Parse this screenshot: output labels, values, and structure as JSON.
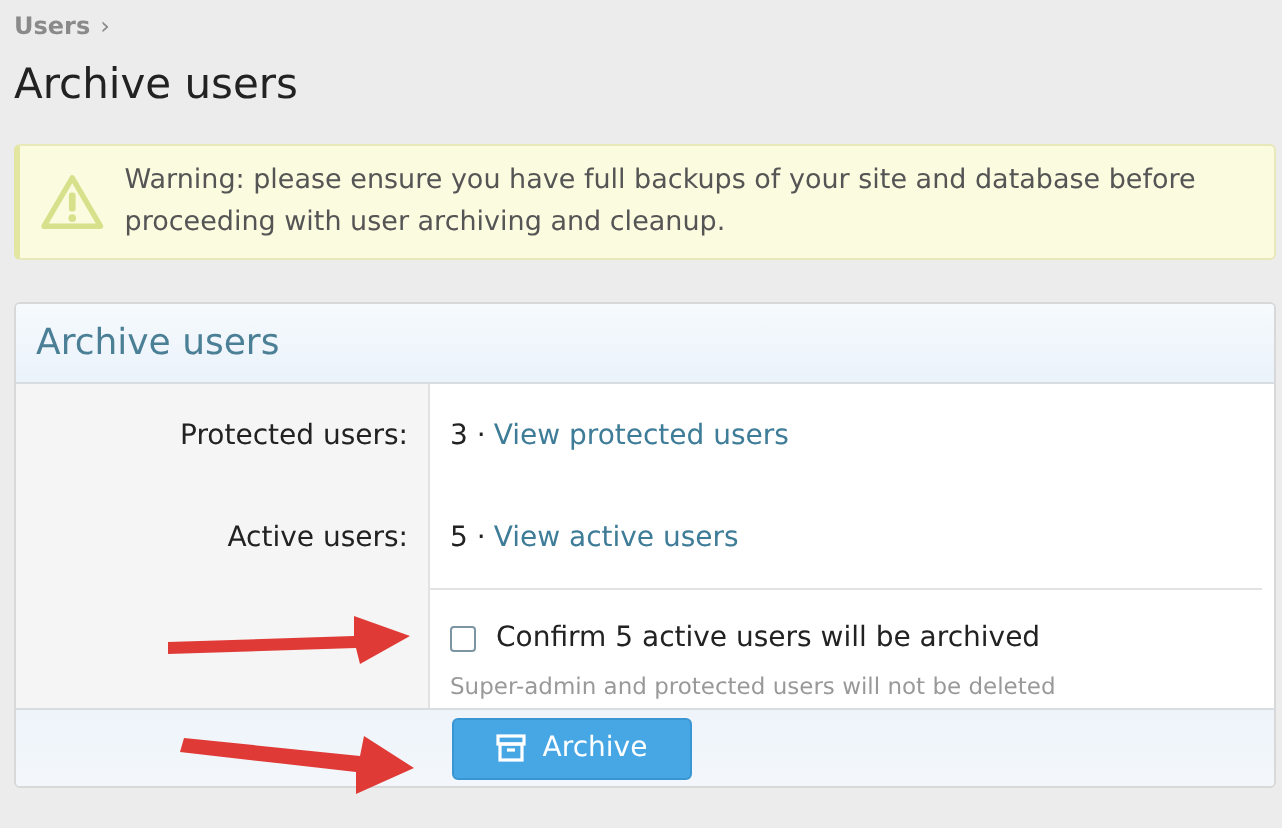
{
  "breadcrumb": {
    "label": "Users",
    "separator": "›"
  },
  "title": "Archive users",
  "warning": {
    "text": "Warning: please ensure you have full backups of your site and database before proceeding with user archiving and cleanup."
  },
  "panel": {
    "title": "Archive users",
    "rows": [
      {
        "label": "Protected users:",
        "count": "3 ·",
        "link": "View protected users"
      },
      {
        "label": "Active users:",
        "count": "5 ·",
        "link": "View active users"
      }
    ],
    "confirm": {
      "label": "Confirm 5 active users will be archived",
      "checked": false,
      "hint": "Super-admin and protected users will not be deleted"
    },
    "button": "Archive"
  }
}
